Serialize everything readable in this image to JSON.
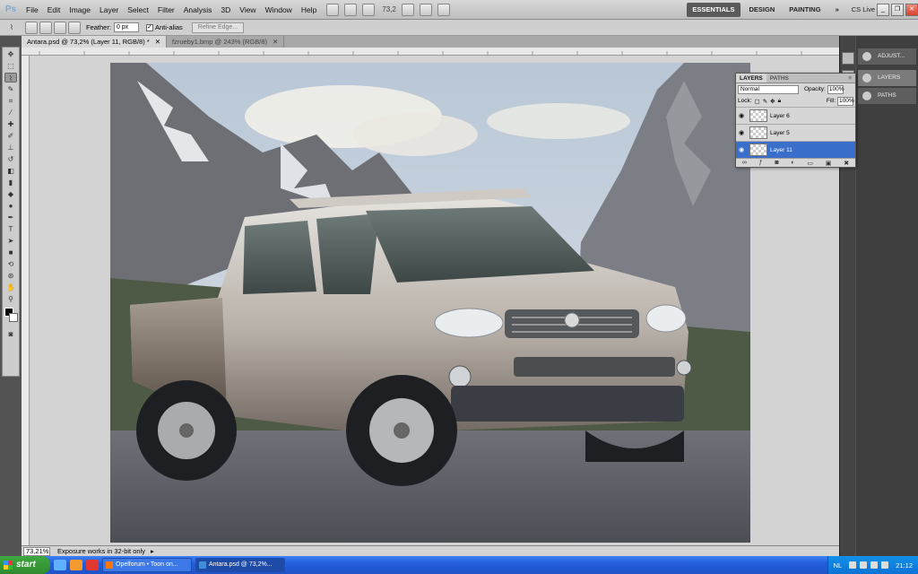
{
  "app": {
    "logo": "Ps"
  },
  "menu": [
    "File",
    "Edit",
    "Image",
    "Layer",
    "Select",
    "Filter",
    "Analysis",
    "3D",
    "View",
    "Window",
    "Help"
  ],
  "appbar": {
    "zoom": "73,2"
  },
  "workspaces": [
    "ESSENTIALS",
    "DESIGN",
    "PAINTING"
  ],
  "cs_live": "CS Live",
  "options": {
    "feather_label": "Feather:",
    "feather_value": "0 px",
    "antialias_label": "Anti-alias",
    "refine_edge": "Refine Edge..."
  },
  "tabs": [
    {
      "label": "Antara.psd @ 73,2% (Layer 11, RGB/8) *"
    },
    {
      "label": "fzrueby1.bmp @ 243% (RGB/8)"
    }
  ],
  "status": {
    "zoom": "73,21%",
    "message": "Exposure works in 32-bit only"
  },
  "right_panel": {
    "adjust": "ADJUST...",
    "layers": "LAYERS",
    "paths": "PATHS"
  },
  "layers_panel": {
    "tabs": [
      "LAYERS",
      "PATHS"
    ],
    "blend_mode": "Normal",
    "opacity_label": "Opacity:",
    "opacity": "100%",
    "lock_label": "Lock:",
    "fill_label": "Fill:",
    "fill": "100%",
    "layers": [
      {
        "name": "Layer 6",
        "selected": false
      },
      {
        "name": "Layer 5",
        "selected": false
      },
      {
        "name": "Layer 11",
        "selected": true
      }
    ]
  },
  "taskbar": {
    "start": "start",
    "tasks": [
      {
        "label": "Opelforum • Toon on...",
        "active": false
      },
      {
        "label": "Antara.psd @ 73,2%...",
        "active": true
      }
    ],
    "lang": "NL",
    "clock": "21:12"
  },
  "colors": {
    "canvas_bg": "#d3d3d3",
    "selected_layer": "#3a6ecb",
    "taskbar": "#245edb"
  }
}
